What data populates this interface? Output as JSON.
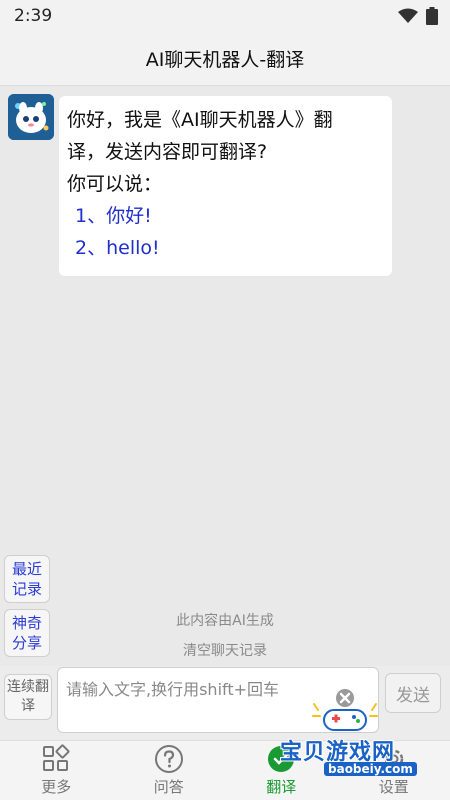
{
  "status_bar": {
    "time": "2:39"
  },
  "header": {
    "title": "AI聊天机器人-翻译"
  },
  "chat": {
    "messages": [
      {
        "lines": [
          "你好，我是《AI聊天机器人》翻",
          "译，发送内容即可翻译?",
          "你可以说："
        ],
        "options": [
          "1、你好!",
          "2、hello!"
        ]
      }
    ],
    "ai_notice": "此内容由AI生成",
    "clear_label": "清空聊天记录"
  },
  "side_buttons": {
    "recent": "最近记录",
    "share": "神奇分享"
  },
  "composer": {
    "continuous_label": "连续翻译",
    "placeholder": "请输入文字,换行用shift+回车",
    "send_label": "发送"
  },
  "bottom_nav": {
    "items": [
      {
        "label": "更多",
        "icon": "grid-icon",
        "active": false
      },
      {
        "label": "问答",
        "icon": "question-icon",
        "active": false
      },
      {
        "label": "翻译",
        "icon": "translate-icon",
        "active": true
      },
      {
        "label": "设置",
        "icon": "settings-icon",
        "active": false
      }
    ]
  },
  "watermark": {
    "brand": "宝贝游戏网",
    "url": "baobeiy.com"
  },
  "colors": {
    "accent": "#1a9a33",
    "link": "#1f2fcf",
    "side_text": "#2a3bd6"
  }
}
